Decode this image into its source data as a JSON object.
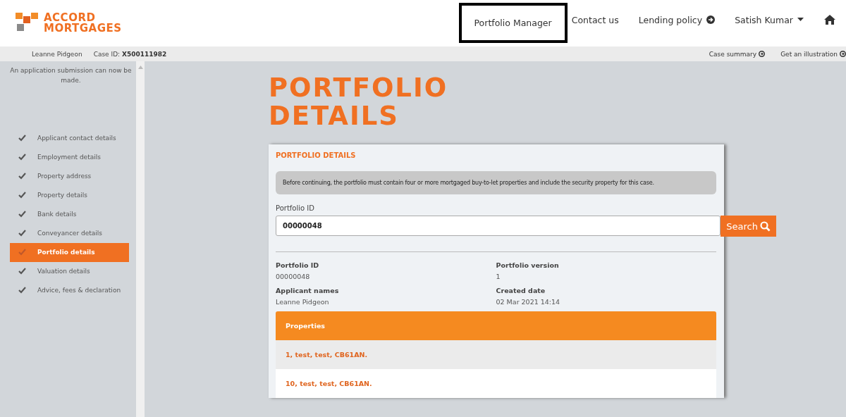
{
  "logo": {
    "line1": "ACCORD",
    "line2": "MORTGAGES"
  },
  "nav": [
    {
      "label": "Portfolio Manager",
      "kind": "link",
      "highlighted": true
    },
    {
      "label": "Contact us",
      "kind": "link",
      "highlighted": false
    },
    {
      "label": "Lending policy",
      "kind": "external",
      "highlighted": false
    },
    {
      "label": "Satish Kumar",
      "kind": "dropdown",
      "highlighted": false
    },
    {
      "kind": "home",
      "highlighted": false
    }
  ],
  "case_bar": {
    "applicant": "Leanne Pidgeon",
    "case_label": "Case ID:",
    "case_id": "X500111982",
    "links": [
      "Case summary",
      "Get an illustration"
    ]
  },
  "sidebar": {
    "notice": "An application submission can now be made.",
    "items": [
      {
        "label": "Applicant contact details",
        "checked": true,
        "selected": false
      },
      {
        "label": "Employment details",
        "checked": true,
        "selected": false
      },
      {
        "label": "Property address",
        "checked": true,
        "selected": false
      },
      {
        "label": "Property details",
        "checked": true,
        "selected": false
      },
      {
        "label": "Bank details",
        "checked": true,
        "selected": false
      },
      {
        "label": "Conveyancer details",
        "checked": true,
        "selected": false
      },
      {
        "label": "Portfolio details",
        "checked": true,
        "selected": true
      },
      {
        "label": "Valuation details",
        "checked": true,
        "selected": false
      },
      {
        "label": "Advice, fees & declaration",
        "checked": true,
        "selected": false
      }
    ]
  },
  "page_title": [
    "PORTFOLIO",
    "DETAILS"
  ],
  "panel": {
    "title": "PORTFOLIO DETAILS",
    "notice": "Before continuing, the portfolio must contain four or more mortgaged buy-to-let properties and include the security property for this case.",
    "field_label": "Portfolio ID",
    "field_value": "00000048",
    "search_button": "Search",
    "details": [
      {
        "label": "Portfolio ID",
        "value": "00000048"
      },
      {
        "label": "Portfolio version",
        "value": "1"
      },
      {
        "label": "Applicant names",
        "value": "Leanne Pidgeon"
      },
      {
        "label": "Created date",
        "value": "02 Mar 2021 14:14"
      }
    ],
    "properties_title": "Properties",
    "properties": [
      "1, test, test, CB61AN.",
      "10, test, test, CB61AN."
    ]
  }
}
